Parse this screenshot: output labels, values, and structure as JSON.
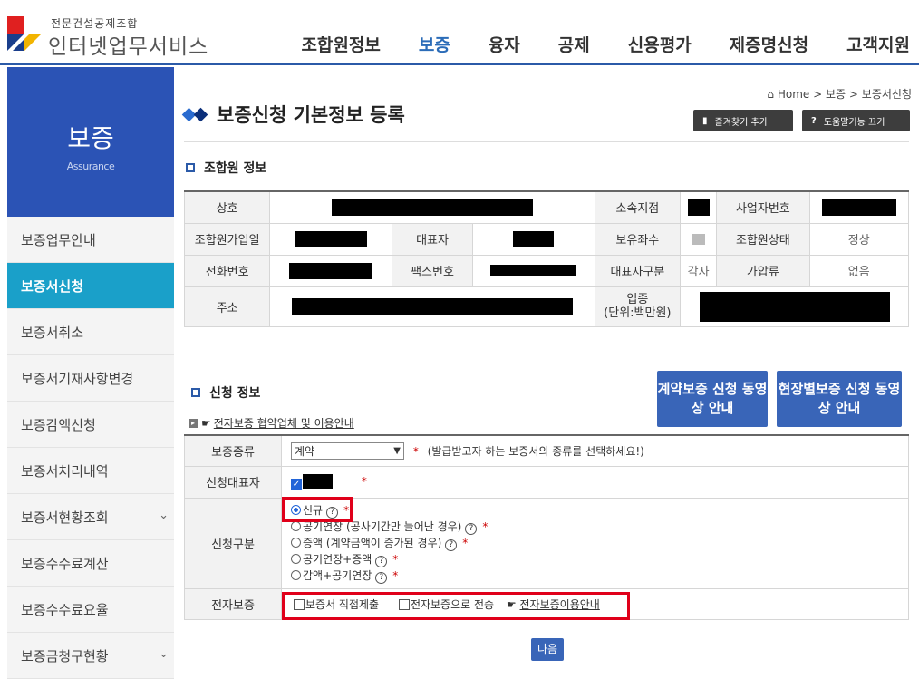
{
  "logo": {
    "sub": "전문건설공제조합",
    "main": "인터넷업무서비스"
  },
  "gnb": [
    "조합원정보",
    "보증",
    "융자",
    "공제",
    "신용평가",
    "제증명신청",
    "고객지원"
  ],
  "side": {
    "title": "보증",
    "subtitle": "Assurance",
    "items": [
      {
        "label": "보증업무안내"
      },
      {
        "label": "보증서신청"
      },
      {
        "label": "보증서취소"
      },
      {
        "label": "보증서기재사항변경"
      },
      {
        "label": "보증감액신청"
      },
      {
        "label": "보증서처리내역"
      },
      {
        "label": "보증서현황조회"
      },
      {
        "label": "보증수수료계산"
      },
      {
        "label": "보증수수료요율"
      },
      {
        "label": "보증금청구현황"
      }
    ]
  },
  "breadcrumb": {
    "home": "Home",
    "sep": ">",
    "level1": "보증",
    "level2": "보증서신청"
  },
  "page_title": "보증신청 기본정보 등록",
  "buttons": {
    "favorite": "즐겨찾기 추가",
    "help_off": "도움말기능 끄기",
    "contract_video": "계약보증 신청 동영상 안내",
    "site_video": "현장별보증 신청 동영상 안내",
    "next": "다음"
  },
  "member_section": {
    "title": "조합원 정보",
    "labels": {
      "name": "상호",
      "branch": "소속지점",
      "bizno": "사업자번호",
      "joindate": "조합원가입일",
      "ceo": "대표자",
      "shares": "보유좌수",
      "status": "조합원상태",
      "phone": "전화번호",
      "fax": "팩스번호",
      "ceotype": "대표자구분",
      "surcharge": "가압류",
      "address": "주소",
      "industry": "업종",
      "industry_unit": "(단위:백만원)"
    },
    "values": {
      "status": "정상",
      "ceotype": "각자",
      "surcharge": "없음"
    }
  },
  "apply_section": {
    "title": "신청 정보",
    "elink": "전자보증 협약업체 및 이용안내",
    "labels": {
      "type": "보증종류",
      "rep": "신청대표자",
      "category": "신청구분",
      "ebond": "전자보증"
    },
    "type_value": "계약",
    "type_hint": "(발급받고자 하는 보증서의 종류를 선택하세요!)",
    "categories": [
      "신규",
      "공기연장 (공사기간만 늘어난 경우)",
      "증액 (계약금액이 증가된 경우)",
      "공기연장+증액",
      "감액+공기연장"
    ],
    "ebond_options": [
      "보증서 직접제출",
      "전자보증으로 전송"
    ],
    "ebond_link": "전자보증이용안내"
  },
  "colors": {
    "primary": "#2b53b5",
    "active_menu": "#1aa0c9",
    "highlight": "#e0001a"
  }
}
